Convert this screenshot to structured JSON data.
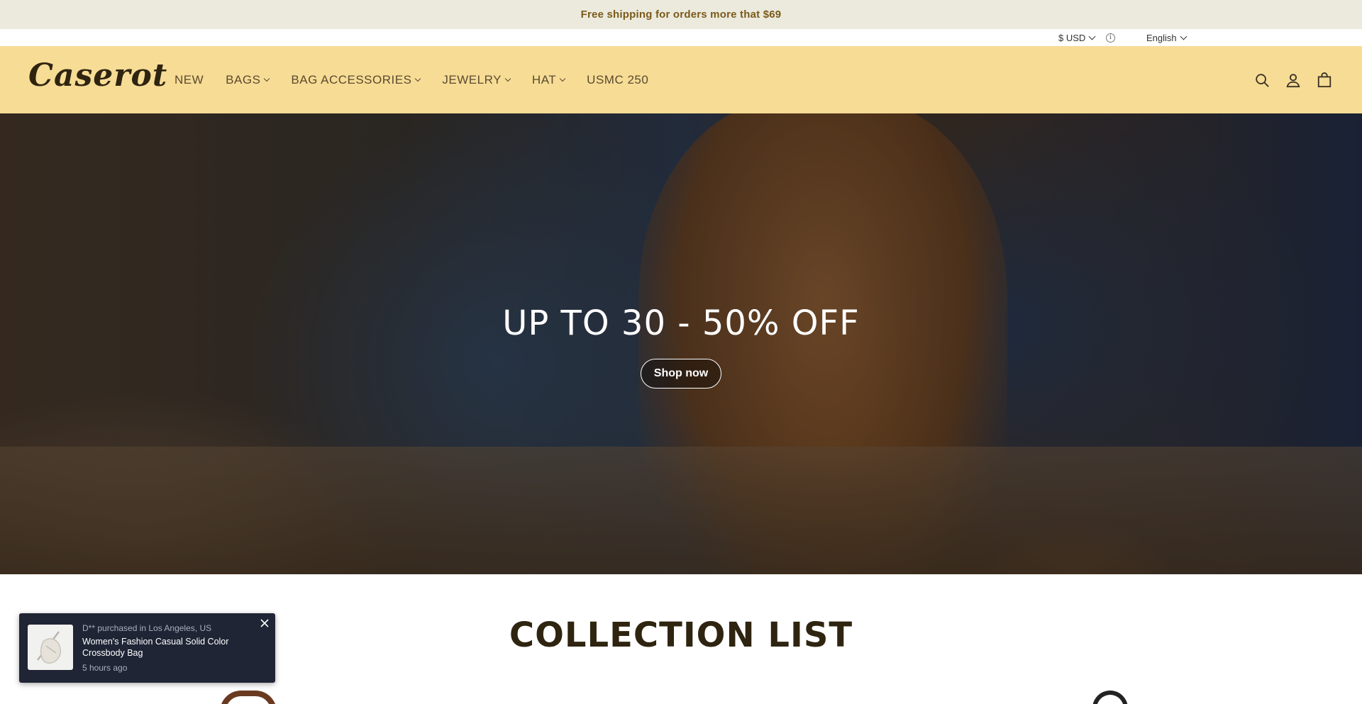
{
  "announcement": {
    "text": "Free shipping for orders more that $69"
  },
  "utility": {
    "currency": "$ USD",
    "info_icon": "info-icon",
    "language": "English"
  },
  "header": {
    "logo": "Caserot",
    "nav": [
      {
        "label": "NEW",
        "has_dropdown": false
      },
      {
        "label": "BAGS",
        "has_dropdown": true
      },
      {
        "label": "BAG ACCESSORIES",
        "has_dropdown": true
      },
      {
        "label": "JEWELRY",
        "has_dropdown": true
      },
      {
        "label": "HAT",
        "has_dropdown": true
      },
      {
        "label": "USMC 250",
        "has_dropdown": false
      }
    ],
    "icons": [
      "search-icon",
      "account-icon",
      "cart-icon"
    ],
    "background_color": "#f7dc95"
  },
  "hero": {
    "title": "UP TO 30 - 50% OFF",
    "button_label": "Shop now"
  },
  "collection": {
    "title": "COLLECTION LIST"
  },
  "toast": {
    "purchase_line": "D** purchased in Los Angeles, US",
    "product": "Women's Fashion Casual Solid Color Crossbody Bag",
    "time": "5 hours ago"
  }
}
